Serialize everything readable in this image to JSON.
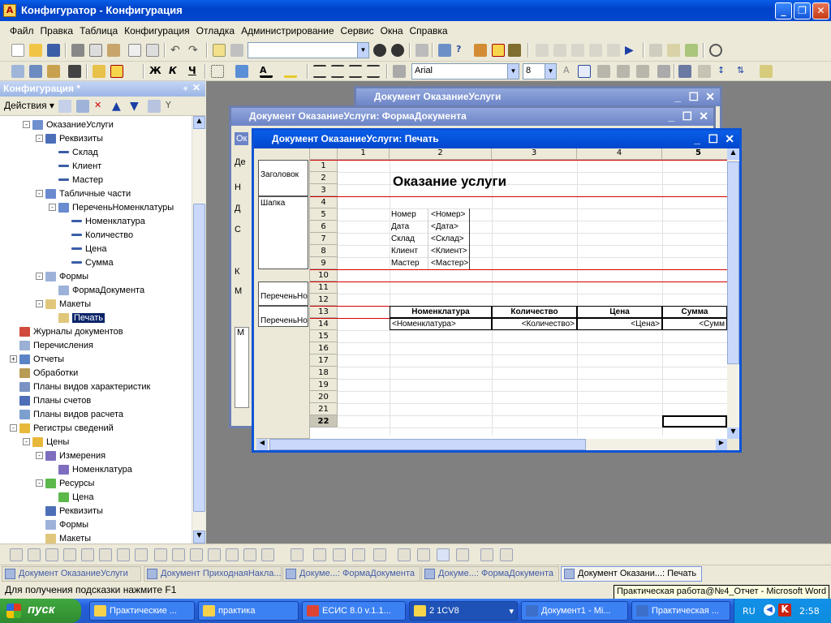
{
  "title": "Конфигуратор - Конфигурация",
  "menu": [
    "Файл",
    "Правка",
    "Таблица",
    "Конфигурация",
    "Отладка",
    "Администрирование",
    "Сервис",
    "Окна",
    "Справка"
  ],
  "toolbar2": {
    "font": "Arial",
    "font_size": "8",
    "bold": "Ж",
    "italic": "К",
    "underline": "Ч"
  },
  "panel": {
    "title": "Конфигурация *",
    "actions": "Действия",
    "tree": [
      {
        "label": "ОказаниеУслуги",
        "level": 2,
        "exp": "-",
        "icon": "doc"
      },
      {
        "label": "Реквизиты",
        "level": 3,
        "exp": "-",
        "icon": "req"
      },
      {
        "label": "Склад",
        "level": 4,
        "icon": "attr"
      },
      {
        "label": "Клиент",
        "level": 4,
        "icon": "attr"
      },
      {
        "label": "Мастер",
        "level": 4,
        "icon": "attr"
      },
      {
        "label": "Табличные части",
        "level": 3,
        "exp": "-",
        "icon": "tab"
      },
      {
        "label": "ПереченьНоменклатуры",
        "level": 4,
        "exp": "-",
        "icon": "tab"
      },
      {
        "label": "Номенклатура",
        "level": 5,
        "icon": "attr"
      },
      {
        "label": "Количество",
        "level": 5,
        "icon": "attr"
      },
      {
        "label": "Цена",
        "level": 5,
        "icon": "attr"
      },
      {
        "label": "Сумма",
        "level": 5,
        "icon": "attr"
      },
      {
        "label": "Формы",
        "level": 3,
        "exp": "-",
        "icon": "form"
      },
      {
        "label": "ФормаДокумента",
        "level": 4,
        "icon": "form"
      },
      {
        "label": "Макеты",
        "level": 3,
        "exp": "-",
        "icon": "mak"
      },
      {
        "label": "Печать",
        "level": 4,
        "icon": "mak",
        "selected": true
      },
      {
        "label": "Журналы документов",
        "level": 1,
        "icon": "jour"
      },
      {
        "label": "Перечисления",
        "level": 1,
        "icon": "enum"
      },
      {
        "label": "Отчеты",
        "level": 1,
        "exp": "+",
        "icon": "rep"
      },
      {
        "label": "Обработки",
        "level": 1,
        "icon": "proc"
      },
      {
        "label": "Планы видов характеристик",
        "level": 1,
        "icon": "pvh"
      },
      {
        "label": "Планы счетов",
        "level": 1,
        "icon": "acc"
      },
      {
        "label": "Планы видов расчета",
        "level": 1,
        "icon": "calc"
      },
      {
        "label": "Регистры сведений",
        "level": 1,
        "exp": "-",
        "icon": "reg"
      },
      {
        "label": "Цены",
        "level": 2,
        "exp": "-",
        "icon": "reg"
      },
      {
        "label": "Измерения",
        "level": 3,
        "exp": "-",
        "icon": "dim"
      },
      {
        "label": "Номенклатура",
        "level": 4,
        "icon": "dim"
      },
      {
        "label": "Ресурсы",
        "level": 3,
        "exp": "-",
        "icon": "res"
      },
      {
        "label": "Цена",
        "level": 4,
        "icon": "res"
      },
      {
        "label": "Реквизиты",
        "level": 3,
        "icon": "req"
      },
      {
        "label": "Формы",
        "level": 3,
        "icon": "form"
      },
      {
        "label": "Макеты",
        "level": 3,
        "icon": "mak"
      }
    ]
  },
  "windows": {
    "back": "Документ ОказаниеУслуги",
    "form": "Документ ОказаниеУслуги: ФормаДокумента",
    "print": "Документ ОказаниеУслуги: Печать",
    "form_partial": [
      "Ок",
      "Де",
      "Н",
      "Д",
      "С",
      "К",
      "М",
      "М"
    ]
  },
  "sheet": {
    "columns": [
      "1",
      "2",
      "3",
      "4",
      "5"
    ],
    "rows": [
      "1",
      "2",
      "3",
      "4",
      "5",
      "6",
      "7",
      "8",
      "9",
      "10",
      "11",
      "12",
      "13",
      "14",
      "15",
      "16",
      "17",
      "18",
      "19",
      "20",
      "21",
      "22"
    ],
    "sections": [
      "Заголовок",
      "Шапка",
      "ПереченьНо",
      "ПереченьНо"
    ],
    "heading": "Оказание услуги",
    "fields": [
      [
        "Номер",
        "<Номер>"
      ],
      [
        "Дата",
        "<Дата>"
      ],
      [
        "Склад",
        "<Склад>"
      ],
      [
        "Клиент",
        "<Клиент>"
      ],
      [
        "Мастер",
        "<Мастер>"
      ]
    ],
    "table_headers": [
      "Номенклатура",
      "Количество",
      "Цена",
      "Сумма"
    ],
    "table_row": [
      "<Номенклатура>",
      "<Количество>",
      "<Цена>",
      "<Сумм"
    ]
  },
  "window_tabs": [
    "Документ ОказаниеУслуги",
    "Документ ПриходнаяНакла...",
    "Докуме...: ФормаДокумента",
    "Докуме...: ФормаДокумента",
    "Документ Оказани...: Печать"
  ],
  "status": "Для получения подсказки нажмите F1",
  "tooltip": "Практическая работа@№4_Отчет - Microsoft Word",
  "taskbar": {
    "start": "пуск",
    "tasks": [
      "Практические ...",
      "практика",
      "ЕСИС 8.0 v.1.1...",
      "2 1CV8",
      "Документ1 - Mi...",
      "Практическая ..."
    ],
    "lang": "RU",
    "time": "2:58"
  }
}
